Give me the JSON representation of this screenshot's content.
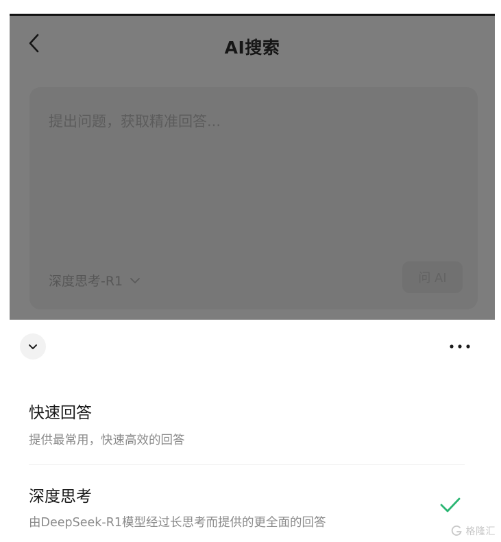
{
  "header": {
    "title": "AI搜索",
    "back_icon": "chevron-left-icon"
  },
  "search_card": {
    "placeholder": "提出问题，获取精准回答...",
    "model_label": "深度思考-R1",
    "model_dropdown_icon": "chevron-down-icon",
    "ask_button_label": "问 AI"
  },
  "sheet": {
    "collapse_icon": "chevron-down-icon",
    "more_icon": "more-horizontal-icon",
    "options": [
      {
        "title": "快速回答",
        "description": "提供最常用，快速高效的回答",
        "selected": false
      },
      {
        "title": "深度思考",
        "description": "由DeepSeek-R1模型经过长思考而提供的更全面的回答",
        "selected": true
      }
    ],
    "check_icon": "check-icon"
  },
  "watermark": {
    "text": "格隆汇"
  },
  "colors": {
    "check": "#2bb673",
    "dim_overlay": "#7d7d7d",
    "title_text": "#1a1a1a",
    "desc_text": "#8a8a8a"
  }
}
